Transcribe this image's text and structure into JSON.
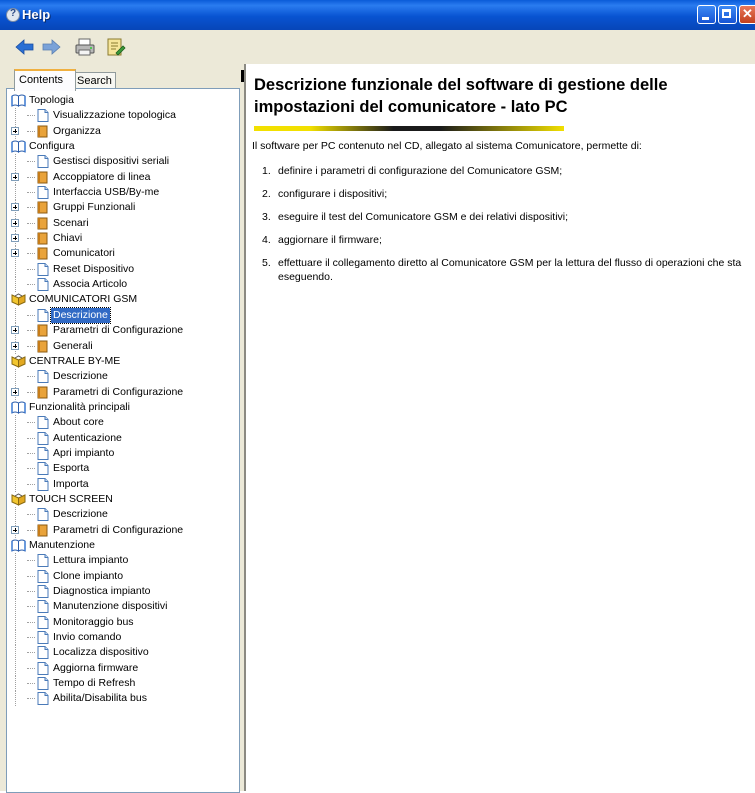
{
  "window": {
    "title": "Help"
  },
  "tabs": [
    {
      "label": "Contents"
    },
    {
      "label": "Search"
    }
  ],
  "tree": [
    {
      "label": "Topologia",
      "icon": "book-open",
      "level": 0
    },
    {
      "label": "Visualizzazione topologica",
      "icon": "page",
      "level": 1
    },
    {
      "label": "Organizza",
      "icon": "book-closed",
      "level": 1,
      "expander": true
    },
    {
      "label": "Configura",
      "icon": "book-open",
      "level": 0
    },
    {
      "label": "Gestisci dispositivi seriali",
      "icon": "page",
      "level": 1
    },
    {
      "label": "Accoppiatore di linea",
      "icon": "book-closed",
      "level": 1,
      "expander": true
    },
    {
      "label": "Interfaccia USB/By-me",
      "icon": "page",
      "level": 1
    },
    {
      "label": "Gruppi Funzionali",
      "icon": "book-closed",
      "level": 1,
      "expander": true
    },
    {
      "label": "Scenari",
      "icon": "book-closed",
      "level": 1,
      "expander": true
    },
    {
      "label": "Chiavi",
      "icon": "book-closed",
      "level": 1,
      "expander": true
    },
    {
      "label": "Comunicatori",
      "icon": "book-closed",
      "level": 1,
      "expander": true
    },
    {
      "label": "Reset Dispositivo",
      "icon": "page",
      "level": 1
    },
    {
      "label": "Associa Articolo",
      "icon": "page",
      "level": 1
    },
    {
      "label": "COMUNICATORI GSM",
      "icon": "book-yellow",
      "level": 0
    },
    {
      "label": "Descrizione",
      "icon": "page",
      "level": 1,
      "selected": true
    },
    {
      "label": "Parametri di Configurazione",
      "icon": "book-closed",
      "level": 1,
      "expander": true
    },
    {
      "label": "Generali",
      "icon": "book-closed",
      "level": 1,
      "expander": true
    },
    {
      "label": "CENTRALE BY-ME",
      "icon": "book-yellow",
      "level": 0
    },
    {
      "label": "Descrizione",
      "icon": "page",
      "level": 1
    },
    {
      "label": "Parametri di Configurazione",
      "icon": "book-closed",
      "level": 1,
      "expander": true
    },
    {
      "label": "Funzionalità principali",
      "icon": "book-open",
      "level": 0
    },
    {
      "label": "About core",
      "icon": "page",
      "level": 1
    },
    {
      "label": "Autenticazione",
      "icon": "page",
      "level": 1
    },
    {
      "label": "Apri impianto",
      "icon": "page",
      "level": 1
    },
    {
      "label": "Esporta",
      "icon": "page",
      "level": 1
    },
    {
      "label": "Importa",
      "icon": "page",
      "level": 1
    },
    {
      "label": "TOUCH SCREEN",
      "icon": "book-yellow",
      "level": 0
    },
    {
      "label": "Descrizione",
      "icon": "page",
      "level": 1
    },
    {
      "label": "Parametri di Configurazione",
      "icon": "book-closed",
      "level": 1,
      "expander": true
    },
    {
      "label": "Manutenzione",
      "icon": "book-open",
      "level": 0
    },
    {
      "label": "Lettura impianto",
      "icon": "page",
      "level": 1
    },
    {
      "label": "Clone impianto",
      "icon": "page",
      "level": 1
    },
    {
      "label": "Diagnostica impianto",
      "icon": "page",
      "level": 1
    },
    {
      "label": "Manutenzione dispositivi",
      "icon": "page",
      "level": 1
    },
    {
      "label": "Monitoraggio bus",
      "icon": "page",
      "level": 1
    },
    {
      "label": "Invio comando",
      "icon": "page",
      "level": 1
    },
    {
      "label": "Localizza dispositivo",
      "icon": "page",
      "level": 1
    },
    {
      "label": "Aggiorna firmware",
      "icon": "page",
      "level": 1
    },
    {
      "label": "Tempo di Refresh",
      "icon": "page",
      "level": 1
    },
    {
      "label": "Abilita/Disabilita bus",
      "icon": "page",
      "level": 1
    }
  ],
  "content": {
    "title": "Descrizione funzionale del software di gestione delle impostazioni del comunicatore - lato PC",
    "intro": "Il software per PC contenuto nel CD, allegato al sistema Comunicatore, permette di:",
    "items": [
      {
        "num": "1.",
        "text": "definire i parametri di configurazione del Comunicatore GSM;"
      },
      {
        "num": "2.",
        "text": "configurare i dispositivi;"
      },
      {
        "num": "3.",
        "text": "eseguire il test del Comunicatore GSM e dei relativi dispositivi;"
      },
      {
        "num": "4.",
        "text": "aggiornare il firmware;"
      },
      {
        "num": "5.",
        "text": "effettuare il collegamento diretto al Comunicatore GSM per la lettura del flusso di operazioni che sta eseguendo."
      }
    ]
  },
  "colors": {
    "titlebar": "#0853d1",
    "selection": "#316ac5",
    "accent_yellow": "#f2e000",
    "toolbar": "#ece9d8"
  },
  "toolbar_icons": [
    "back-arrow-icon",
    "forward-arrow-icon",
    "print-icon",
    "options-icon"
  ]
}
